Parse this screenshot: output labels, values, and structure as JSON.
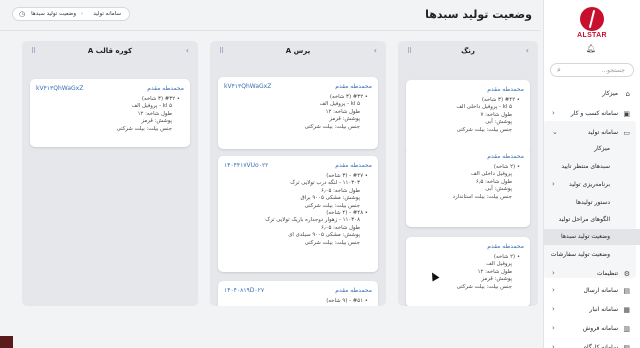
{
  "brand": {
    "name": "ALSTAR",
    "color": "#c8102e"
  },
  "sidebar": {
    "search_placeholder": "جستجو...",
    "items": [
      {
        "label": "میزکار",
        "icon": "home-icon",
        "glyph": "⌂",
        "chevron": false
      },
      {
        "label": "سامانه کسب و کار",
        "icon": "briefcase-icon",
        "glyph": "▣",
        "chevron": true
      },
      {
        "label": "سامانه تولید",
        "icon": "folder-icon",
        "glyph": "▭",
        "chevron": true,
        "expanded": true
      },
      {
        "label": "میزکار",
        "sub": true
      },
      {
        "label": "سبدهای منتظر تایید",
        "sub": true
      },
      {
        "label": "برنامه‌ریزی تولید",
        "sub": true,
        "chevron": true
      },
      {
        "label": "دستور تولیدها",
        "sub": true
      },
      {
        "label": "الگوهای مراحل تولید",
        "sub": true
      },
      {
        "label": "وضعیت تولید سبدها",
        "sub": true,
        "active": true
      },
      {
        "label": "وضعیت تولید سفارشات",
        "sub": true
      },
      {
        "label": "تنظیمات",
        "icon": "gear-icon",
        "glyph": "⚙",
        "chevron": true
      },
      {
        "label": "سامانه ارسال",
        "icon": "truck-icon",
        "glyph": "▤",
        "chevron": true
      },
      {
        "label": "سامانه انبار",
        "icon": "warehouse-icon",
        "glyph": "▦",
        "chevron": true
      },
      {
        "label": "سامانه فروش",
        "icon": "cart-icon",
        "glyph": "▥",
        "chevron": true
      },
      {
        "label": "سامانه کارگاه",
        "icon": "tool-icon",
        "glyph": "▧",
        "chevron": true
      }
    ]
  },
  "header": {
    "title": "وضعیت تولید سبدها",
    "breadcrumb": [
      "سامانه تولید",
      "وضعیت تولید سبدها"
    ],
    "breadcrumb_icon": "clock-icon"
  },
  "columns": [
    {
      "title": "رنگ",
      "cards": [
        {
          "author": "محمدطه مقدم",
          "code": "",
          "lines": [
            "• #۴۲ (۳ شاخه)",
            "۵ kl - پروفیل داخلی الف",
            "طول شاخه: ۷",
            "پوشش: آبی",
            "جنس بیلت: بیلت شرکتی"
          ]
        },
        {
          "author": "محمدطه مقدم",
          "code": "",
          "lines": [
            "• (۲ شاخه)",
            "پروفیل داخلی الف",
            "طول شاخه: ۶٫۵",
            "پوشش: آبی",
            "جنس بیلت: بیلت استاندارد"
          ]
        },
        {
          "author": "محمدطه مقدم",
          "code": "",
          "lines": [
            "• (۲ شاخه)",
            "پروفیل الف",
            "طول شاخه: ۱۲",
            "پوشش: قرمز",
            "جنس بیلت: بیلت شرکتی"
          ]
        }
      ]
    },
    {
      "title": "پرس A",
      "cards": [
        {
          "author": "محمدطه مقدم",
          "code": "kV۴۱۳QhWaGxZ",
          "lines": [
            "• #۳۲ (۳ شاخه)",
            "۵ kl - پروفیل الف",
            "طول شاخه: ۱۲",
            "پوشش: قرمز",
            "جنس بیلت: بیلت شرکتی"
          ]
        },
        {
          "author": "محمدطه مقدم",
          "code": "۱۴۰۴۴۱۷VUo۰۲۲",
          "lines": [
            "• #۴۷ - (۳ شاخه)",
            "۱۱۰۳۰۳ - لنگه درب تولایی ترک",
            "طول شاخه: ۶٫۰۵",
            "پوشش: مشکی ۹۰۰۵ براق",
            "جنس بیلت: بیلت شرکتی",
            "• #۴۸ - (۴ شاخه)",
            "۱۱۰۳۰۸ - زهوار دوجداره باریک تولایی ترک",
            "طول شاخه: ۶٫۰۵",
            "پوشش: مشکی ۹۰۰۵ سیلدی ای",
            "جنس بیلت: بیلت شرکتی"
          ]
        },
        {
          "author": "محمدطه مقدم",
          "code": "۱۴۰۴۰۸۱۹D۰۲۷",
          "lines": [
            "• #۵۱ - (۹ شاخه)"
          ]
        }
      ]
    },
    {
      "title": "کوره قالب A",
      "cards": [
        {
          "author": "محمدطه مقدم",
          "code": "kV۴۱۳QhWaGxZ",
          "lines": [
            "• #۳۲ (۳ شاخه)",
            "۵ kl - پروفیل الف",
            "طول شاخه: ۱۲",
            "پوشش: قرمز",
            "جنس بیلت: بیلت شرکتی"
          ]
        }
      ]
    }
  ]
}
